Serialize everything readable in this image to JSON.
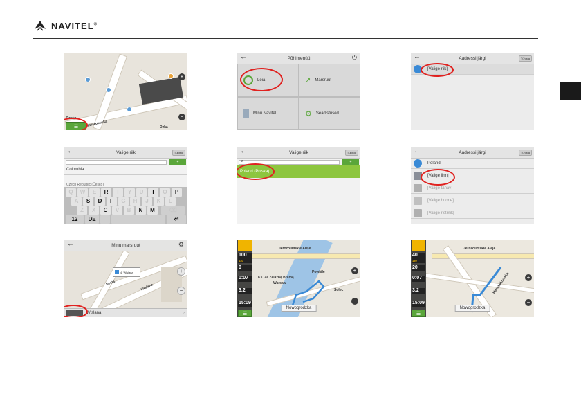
{
  "brand": {
    "name": "NAVITEL",
    "mark": "®"
  },
  "shot1": {
    "label_left": "Swska",
    "street": "Pawaikowska",
    "street2": "Dzka"
  },
  "shot2": {
    "title": "Põhimenüü",
    "tiles": [
      "Leia",
      "Marsruut",
      "Minu Navitel",
      "Seadistused"
    ]
  },
  "shot3": {
    "title": "Aadressi järgi",
    "pill": "Tühista",
    "row": "[Valige riik]"
  },
  "shot4": {
    "title": "Valige riik",
    "pill": "Tühista",
    "items": [
      "Colombia",
      "Czech Republic (Česko)"
    ],
    "keys_row1": [
      "Q",
      "W",
      "E",
      "R",
      "T",
      "Y",
      "U",
      "I",
      "O",
      "P"
    ],
    "keys_row2": [
      "A",
      "S",
      "D",
      "F",
      "G",
      "H",
      "J",
      "K",
      "L"
    ],
    "keys_row3": [
      "Z",
      "X",
      "C",
      "V",
      "B",
      "N",
      "M"
    ],
    "key_num": "12",
    "key_lang": "DE",
    "active_keys": [
      "R",
      "I",
      "P",
      "S",
      "D",
      "F",
      "C",
      "N",
      "M"
    ]
  },
  "shot5": {
    "title": "Valige riik",
    "pill": "Tühista",
    "input": "P",
    "result": "Poland (Polska)"
  },
  "shot6": {
    "title": "Aadressi järgi",
    "pill": "Tühista",
    "rows": [
      "Poland",
      "[Valige linn]",
      "[Valige tänav]",
      "[Valige hoone]",
      "[Valige ristmik]"
    ]
  },
  "shot7": {
    "title": "Minu marsruut",
    "popup": "4, Wislana",
    "footer": "Wislana",
    "street1": "Wislana",
    "street2": "Sesta"
  },
  "shot8": {
    "speed": "100",
    "limit": "130",
    "dist": "0",
    "time1": "0:07",
    "dist2": "3.2",
    "clock": "15:09",
    "street": "Nowogrodzka",
    "labels": [
      "Jerozolimskie Aleje",
      "Ks. Za Zelazną Bramą",
      "Warsaw",
      "Powiśle",
      "Solec"
    ]
  },
  "shot9": {
    "speed": "40",
    "limit": "130",
    "dist": "20",
    "time1": "0:07",
    "dist2": "3.2",
    "clock": "15:09",
    "street": "Nowogrodzka",
    "labels": [
      "Jerozolimskie Aleje",
      "Marszałkowska"
    ]
  }
}
